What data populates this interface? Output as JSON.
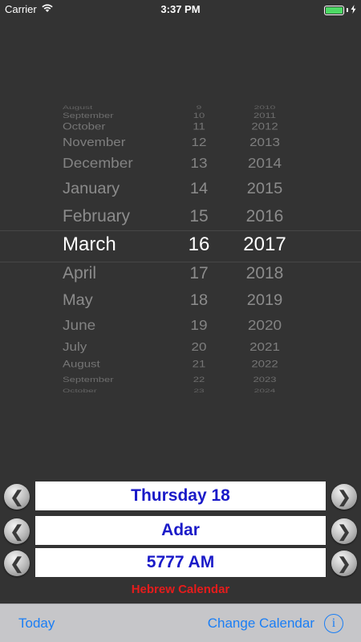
{
  "status_bar": {
    "carrier": "Carrier",
    "time": "3:37 PM",
    "wifi_icon": "wifi-icon",
    "battery_level": 1.0,
    "battery_color": "#4cd964",
    "charging_icon": "bolt-icon"
  },
  "picker": {
    "rows": [
      {
        "month": "August",
        "day": "9",
        "year": "2010"
      },
      {
        "month": "September",
        "day": "10",
        "year": "2011"
      },
      {
        "month": "October",
        "day": "11",
        "year": "2012"
      },
      {
        "month": "November",
        "day": "12",
        "year": "2013"
      },
      {
        "month": "December",
        "day": "13",
        "year": "2014"
      },
      {
        "month": "January",
        "day": "14",
        "year": "2015"
      },
      {
        "month": "February",
        "day": "15",
        "year": "2016"
      },
      {
        "month": "March",
        "day": "16",
        "year": "2017"
      },
      {
        "month": "April",
        "day": "17",
        "year": "2018"
      },
      {
        "month": "May",
        "day": "18",
        "year": "2019"
      },
      {
        "month": "June",
        "day": "19",
        "year": "2020"
      },
      {
        "month": "July",
        "day": "20",
        "year": "2021"
      },
      {
        "month": "August",
        "day": "21",
        "year": "2022"
      },
      {
        "month": "September",
        "day": "22",
        "year": "2023"
      },
      {
        "month": "October",
        "day": "23",
        "year": "2024"
      }
    ],
    "selected_index": 7
  },
  "hebrew": {
    "day": "Thursday 18",
    "month": "Adar",
    "year": "5777 AM",
    "calendar_label": "Hebrew Calendar",
    "prev_icon": "chevron-left-icon",
    "next_icon": "chevron-right-icon",
    "value_color": "#1a1ac8",
    "label_color": "#e51c1c"
  },
  "toolbar": {
    "today_label": "Today",
    "change_label": "Change Calendar",
    "info_icon": "info-icon",
    "info_glyph": "i",
    "accent": "#1a7ef5"
  }
}
